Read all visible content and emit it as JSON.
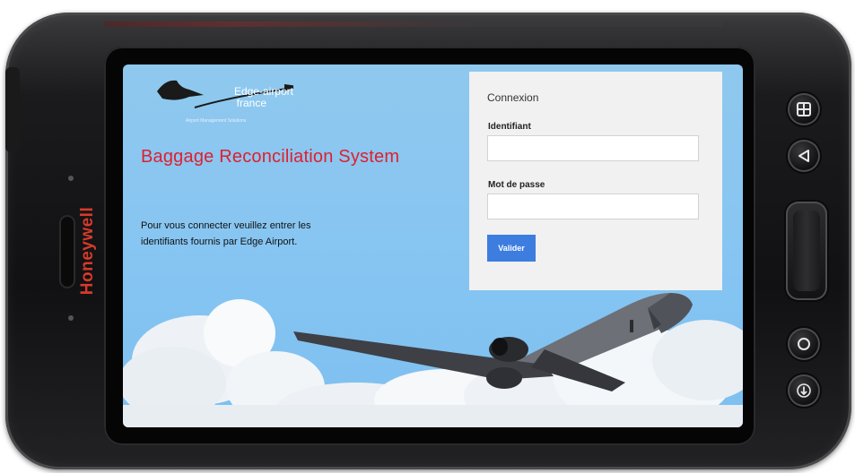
{
  "device": {
    "brand": "Honeywell"
  },
  "logo": {
    "line1": "Edge-airport",
    "line2": "france",
    "tagline": "Airport Management Solutions"
  },
  "page": {
    "title": "Baggage Reconciliation System",
    "intro": "Pour vous connecter veuillez entrer les identifiants fournis par Edge Airport."
  },
  "login": {
    "heading": "Connexion",
    "username_label": "Identifiant",
    "username_value": "",
    "password_label": "Mot de passe",
    "password_value": "",
    "submit_label": "Valider"
  },
  "colors": {
    "sky": "#86c5f2",
    "title_red": "#e01f2e",
    "button_blue": "#3d7de0",
    "panel": "#f1f1f1",
    "brand_red": "#d63a2a"
  },
  "hardware_buttons": [
    "grid-icon",
    "back-triangle-icon",
    "volume-rocker",
    "circle-home-icon",
    "down-arrow-icon"
  ]
}
